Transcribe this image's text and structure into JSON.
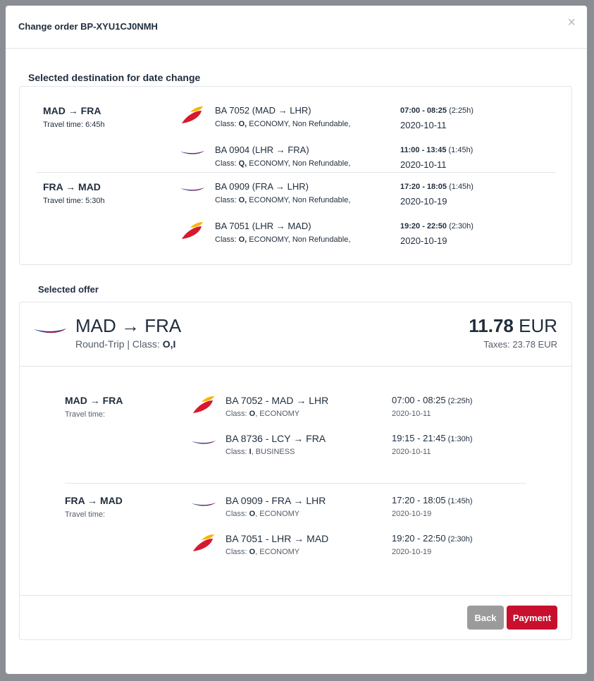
{
  "modal": {
    "title": "Change order BP-XYU1CJ0NMH",
    "close": "×"
  },
  "selected_destination": {
    "heading": "Selected destination for date change",
    "legs": [
      {
        "route": "MAD → FRA",
        "travel_time": "Travel time: 6:45h",
        "segments": [
          {
            "airline": "iberia",
            "flight": "BA 7052 (MAD → LHR)",
            "class_code": "O,",
            "class_rest": " ECONOMY, Non Refundable,",
            "time": "07:00 - 08:25",
            "duration": " (2:25h)",
            "date": "2020-10-11"
          },
          {
            "airline": "british",
            "flight": "BA 0904 (LHR → FRA)",
            "class_code": "Q,",
            "class_rest": " ECONOMY, Non Refundable,",
            "time": "11:00 - 13:45",
            "duration": " (1:45h)",
            "date": "2020-10-11"
          }
        ]
      },
      {
        "route": "FRA → MAD",
        "travel_time": "Travel time: 5:30h",
        "segments": [
          {
            "airline": "british",
            "flight": "BA 0909 (FRA → LHR)",
            "class_code": "O,",
            "class_rest": " ECONOMY, Non Refundable,",
            "time": "17:20 - 18:05",
            "duration": " (1:45h)",
            "date": "2020-10-19"
          },
          {
            "airline": "iberia",
            "flight": "BA 7051 (LHR → MAD)",
            "class_code": "O,",
            "class_rest": " ECONOMY, Non Refundable,",
            "time": "19:20 - 22:50",
            "duration": " (2:30h)",
            "date": "2020-10-19"
          }
        ]
      }
    ]
  },
  "selected_offer": {
    "heading": "Selected offer",
    "route": "MAD → FRA",
    "trip_type": "Round-Trip | Class: ",
    "classes": "O,I",
    "price_amount": "11.78",
    "price_currency": " EUR",
    "taxes": "Taxes: 23.78 EUR",
    "legs": [
      {
        "route": "MAD → FRA",
        "travel_time": "Travel time:",
        "segments": [
          {
            "airline": "iberia",
            "flight": "BA 7052 - MAD → LHR",
            "class_label": "Class: ",
            "class_code": "O",
            "class_rest": ", ECONOMY",
            "time": "07:00 - 08:25",
            "duration": " (2:25h)",
            "date": "2020-10-11"
          },
          {
            "airline": "british",
            "flight": "BA 8736 - LCY → FRA",
            "class_label": "Class: ",
            "class_code": "I",
            "class_rest": ", BUSINESS",
            "time": "19:15 - 21:45",
            "duration": " (1:30h)",
            "date": "2020-10-11"
          }
        ]
      },
      {
        "route": "FRA → MAD",
        "travel_time": "Travel time:",
        "segments": [
          {
            "airline": "british",
            "flight": "BA 0909 - FRA → LHR",
            "class_label": "Class: ",
            "class_code": "O",
            "class_rest": ", ECONOMY",
            "time": "17:20 - 18:05",
            "duration": " (1:45h)",
            "date": "2020-10-19"
          },
          {
            "airline": "iberia",
            "flight": "BA 7051 - LHR → MAD",
            "class_label": "Class: ",
            "class_code": "O",
            "class_rest": ", ECONOMY",
            "time": "19:20 - 22:50",
            "duration": " (2:30h)",
            "date": "2020-10-19"
          }
        ]
      }
    ],
    "buttons": {
      "back": "Back",
      "payment": "Payment"
    }
  },
  "colors": {
    "payment": "#c8102e",
    "back": "#9b9b9b",
    "iberia_red": "#d7192d",
    "iberia_yellow": "#f7b500",
    "ba_blue": "#1e3f8f",
    "ba_red": "#c8102e"
  }
}
